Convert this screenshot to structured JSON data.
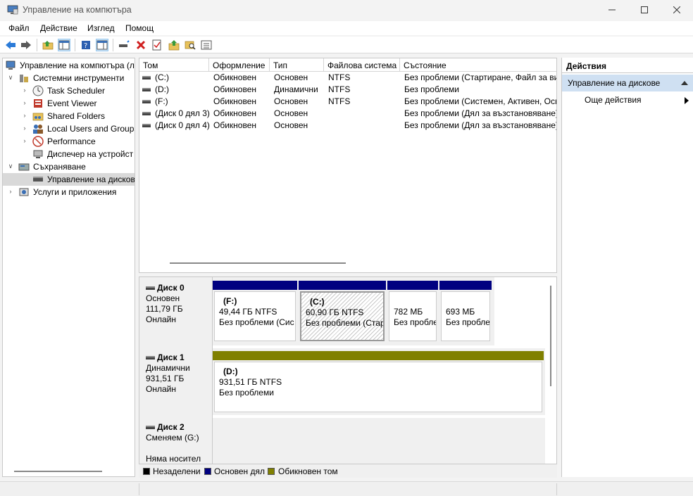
{
  "window": {
    "title": "Управление на компютъра",
    "controls": {
      "minimize": "—",
      "maximize": "☐",
      "close": "✕"
    }
  },
  "menu": [
    "Файл",
    "Действие",
    "Изглед",
    "Помощ"
  ],
  "tree": {
    "root": "Управление на компютъра (л",
    "system_tools": "Системни инструменти",
    "task_scheduler": "Task Scheduler",
    "event_viewer": "Event Viewer",
    "shared_folders": "Shared Folders",
    "local_users": "Local Users and Groups",
    "performance": "Performance",
    "device_manager": "Диспечер на устройст",
    "storage": "Съхраняване",
    "disk_management": "Управление на дисков",
    "services": "Услуги и приложения"
  },
  "list": {
    "columns": [
      "Том",
      "Оформление",
      "Тип",
      "Файлова система",
      "Състояние"
    ],
    "rows": [
      [
        "(C:)",
        "Обикновен",
        "Основен",
        "NTFS",
        "Без проблеми (Стартиране, Файл за вир"
      ],
      [
        "(D:)",
        "Обикновен",
        "Динамични",
        "NTFS",
        "Без проблеми"
      ],
      [
        "(F:)",
        "Обикновен",
        "Основен",
        "NTFS",
        "Без проблеми (Системен, Активен, Осн"
      ],
      [
        "(Диск 0 дял 3)",
        "Обикновен",
        "Основен",
        "",
        "Без проблеми (Дял за възстановяване)"
      ],
      [
        "(Диск 0 дял 4)",
        "Обикновен",
        "Основен",
        "",
        "Без проблеми (Дял за възстановяване)"
      ]
    ]
  },
  "disks": [
    {
      "name": "Диск 0",
      "type": "Основен",
      "size": "111,79 ГБ",
      "status": "Онлайн"
    },
    {
      "name": "Диск 1",
      "type": "Динамични",
      "size": "931,51 ГБ",
      "status": "Онлайн"
    },
    {
      "name": "Диск 2",
      "type": "Сменяем (G:)",
      "size": "",
      "status": "Няма носител"
    }
  ],
  "partitions": {
    "d0p1": {
      "name": "(F:)",
      "size": "49,44 ГБ NTFS",
      "status": "Без проблеми (Сис"
    },
    "d0p2": {
      "name": "(C:)",
      "size": "60,90 ГБ NTFS",
      "status": "Без проблеми (Стар"
    },
    "d0p3": {
      "name": "",
      "size": "782 МБ",
      "status": "Без пробле"
    },
    "d0p4": {
      "name": "",
      "size": "693 МБ",
      "status": "Без пробле"
    },
    "d1p1": {
      "name": "(D:)",
      "size": "931,51 ГБ NTFS",
      "status": "Без проблеми"
    }
  },
  "legend": {
    "unallocated": "Незаделени",
    "primary": "Основен дял",
    "simple": "Обикновен том"
  },
  "colors": {
    "primary_band": "#000080",
    "simple_band": "#808000",
    "unallocated": "#000000"
  },
  "actions": {
    "header": "Действия",
    "selected": "Управление на дискове",
    "more": "Още действия"
  }
}
